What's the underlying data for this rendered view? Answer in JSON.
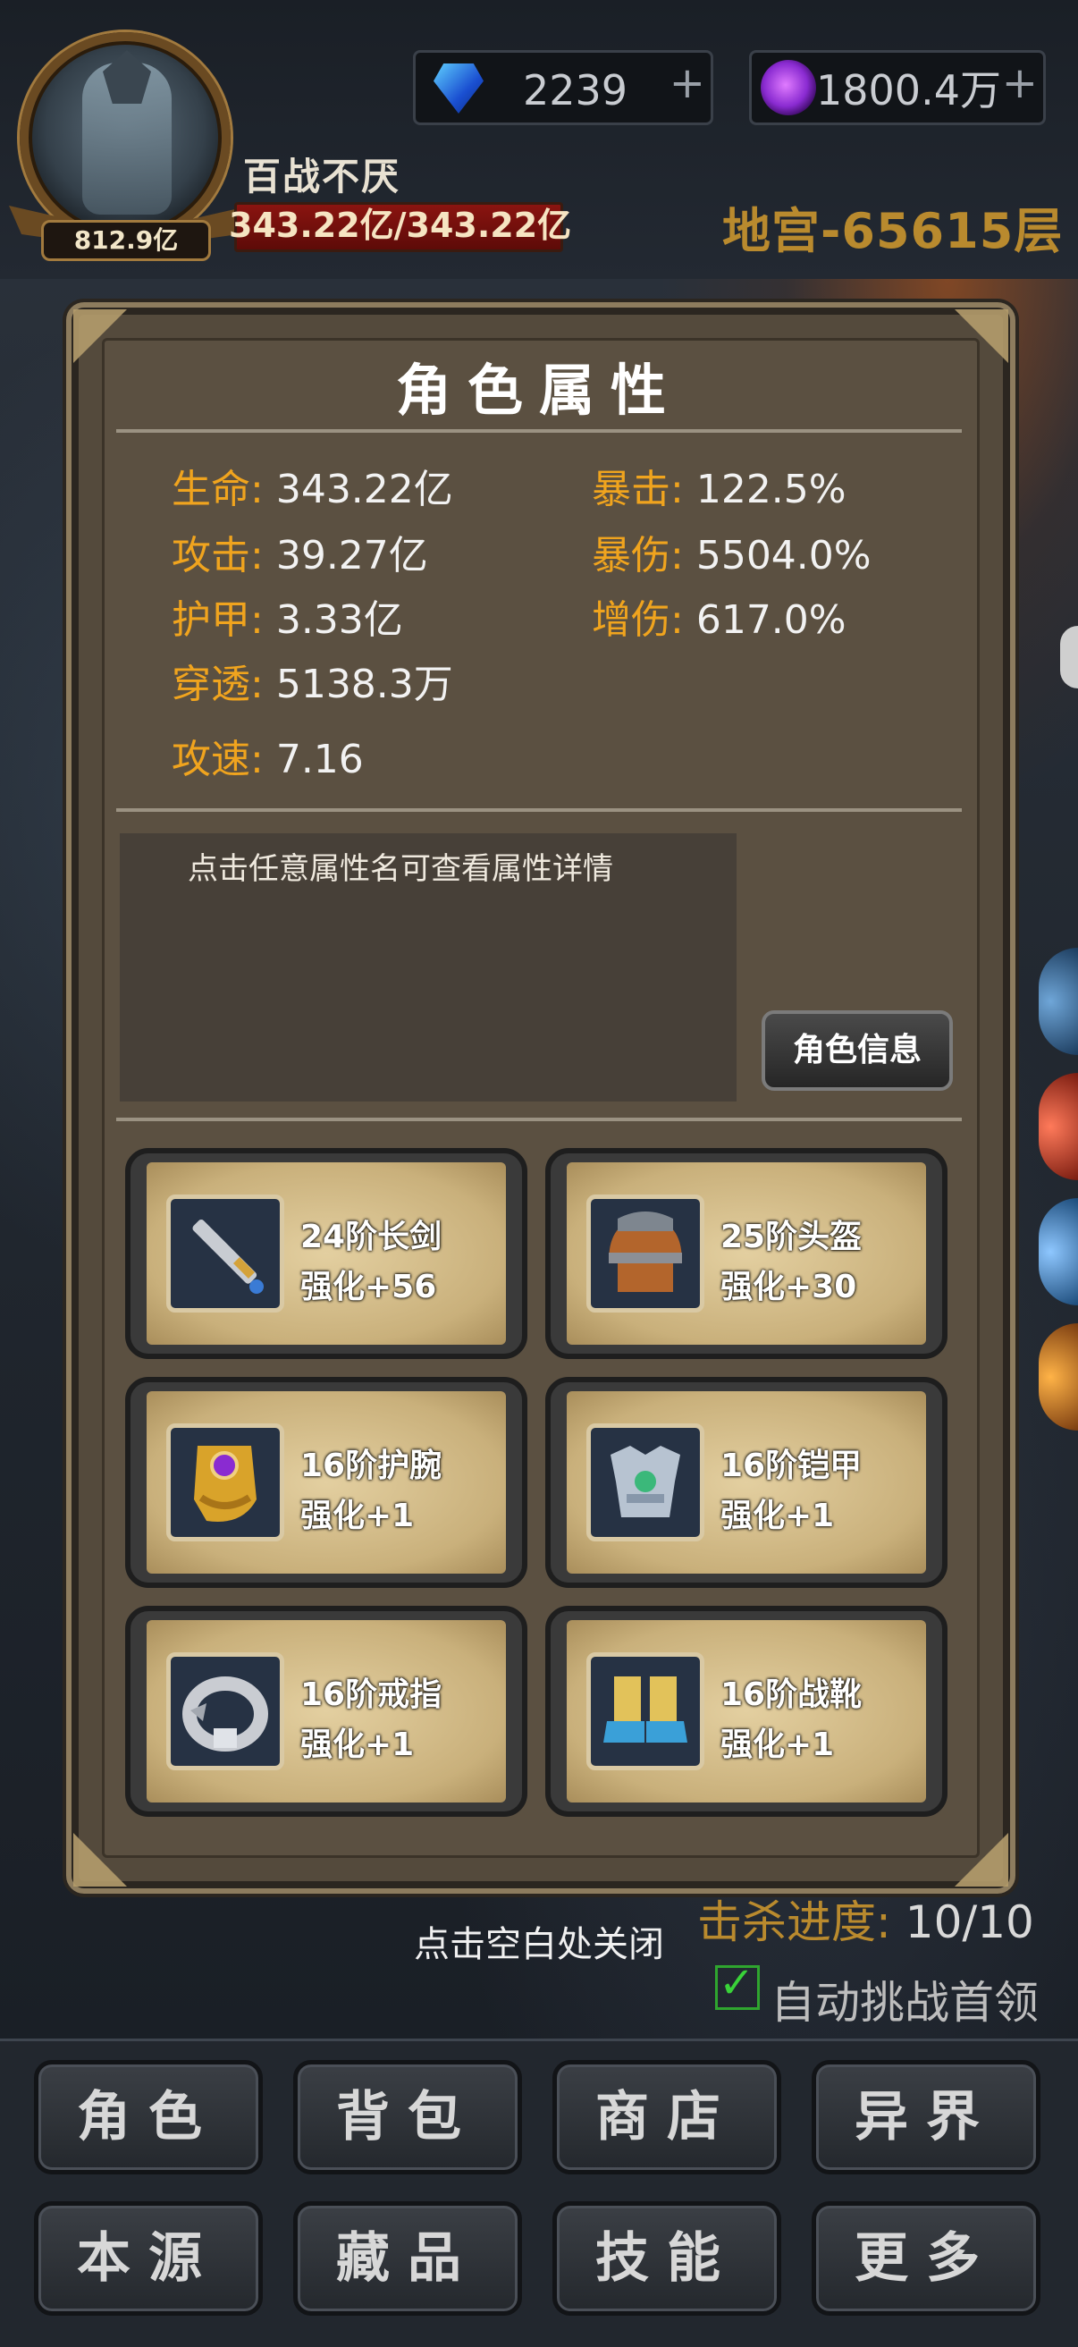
{
  "player": {
    "name": "百战不厌",
    "power": "812.9亿",
    "hp": "343.22亿/343.22亿"
  },
  "currency": {
    "gems": "2239",
    "orbs": "1800.4万",
    "plus": "+"
  },
  "floor": "地宫-65615层",
  "panel": {
    "title": "角色属性",
    "stats_left": [
      {
        "key": "生命:",
        "value": "343.22亿"
      },
      {
        "key": "攻击:",
        "value": "39.27亿"
      },
      {
        "key": "护甲:",
        "value": "3.33亿"
      },
      {
        "key": "穿透:",
        "value": "5138.3万"
      },
      {
        "key": "攻速:",
        "value": "7.16"
      }
    ],
    "stats_right": [
      {
        "key": "暴击:",
        "value": "122.5%"
      },
      {
        "key": "暴伤:",
        "value": "5504.0%"
      },
      {
        "key": "增伤:",
        "value": "617.0%"
      }
    ],
    "hint": "点击任意属性名可查看属性详情",
    "info_button": "角色信息",
    "equipment": [
      {
        "name": "24阶长剑",
        "level": "强化+56",
        "icon": "sword-icon"
      },
      {
        "name": "25阶头盔",
        "level": "强化+30",
        "icon": "helmet-icon"
      },
      {
        "name": "16阶护腕",
        "level": "强化+1",
        "icon": "bracer-icon"
      },
      {
        "name": "16阶铠甲",
        "level": "强化+1",
        "icon": "armor-icon"
      },
      {
        "name": "16阶戒指",
        "level": "强化+1",
        "icon": "ring-icon"
      },
      {
        "name": "16阶战靴",
        "level": "强化+1",
        "icon": "boots-icon"
      }
    ]
  },
  "close_hint": "点击空白处关闭",
  "kill_progress": {
    "label": "击杀进度:",
    "value": "10/10"
  },
  "auto_challenge": {
    "label": "自动挑战首领",
    "checked": true
  },
  "nav": [
    "角色",
    "背包",
    "商店",
    "异界",
    "本源",
    "藏品",
    "技能",
    "更多"
  ]
}
